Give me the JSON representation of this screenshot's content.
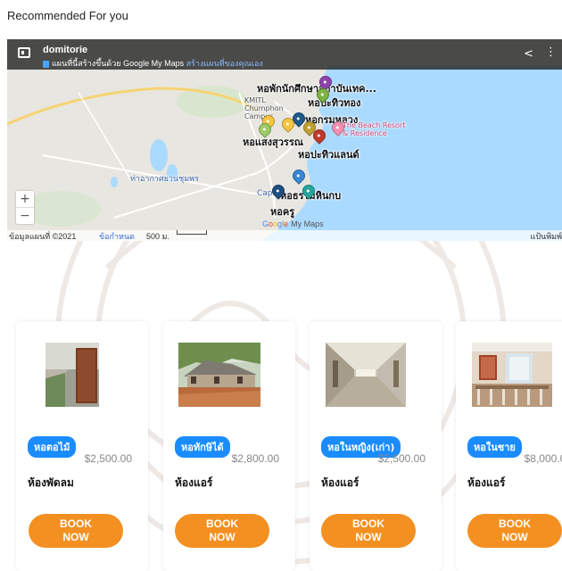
{
  "section_title": "Recommended For you",
  "map": {
    "title": "domitorie",
    "subtitle_text": "แผนที่นี้สร้างขึ้นด้วย Google My Maps",
    "subtitle_link": "สร้างแผนที่ของคุณเอง",
    "icons": [
      "map-menu-icon",
      "info-icon",
      "share-icon",
      "more-icon",
      "zoom-in-icon",
      "zoom-out-icon",
      "map-pin-icon"
    ],
    "places": {
      "kmitl_campus": "KMITL\nChumphon\nCampus",
      "dorm_student": "หอพักนักศึกษาสถาบันเทค...",
      "dorm_pattong": "หอปะทิวทอง",
      "dorm_romluang": "หอกรมหลวง",
      "beach_resort": "The Beach Resort\n& Residence",
      "dorm_saengsuwan": "หอแสงสุวรรณ",
      "dorm_patiw_island": "หอปะทิวแลนด์",
      "airport": "ท่าอากาศยานชุมพร",
      "dorm_hinkob": "หอธรรมหินกบ",
      "capo": "Cap",
      "dorm_khru": "หอครู"
    },
    "zoom_in": "+",
    "zoom_out": "−",
    "google_logo": [
      "G",
      "o",
      "o",
      "g",
      "l",
      "e"
    ],
    "my_maps": "My Maps",
    "footer": {
      "copyright": "ข้อมูลแผนที่ ©2021",
      "terms": "ข้อกำหนด",
      "scale": "500 ม.",
      "keyboard": "แป้นพิมพ์"
    },
    "colors": {
      "sea": "#aadaff",
      "land": "#e8e6e0",
      "road": "#ffffff",
      "highway": "#f6d473"
    }
  },
  "cards": [
    {
      "badge": "หอตอไม้",
      "price": "$2,500.00",
      "name": "ห้องพัดลม",
      "button": "BOOK\nNOW"
    },
    {
      "badge": "หอทักษิได้",
      "price": "$2,800.00",
      "name": "ห้องแอร์",
      "button": "BOOK\nNOW"
    },
    {
      "badge": "หอในหญิง(เก่า)",
      "price": "$2,500.00",
      "name": "ห้องแอร์",
      "button": "BOOK\nNOW"
    },
    {
      "badge": "หอในชาย",
      "price": "$8,000.00",
      "name": "ห้องแอร์",
      "button": "BOOK\nNOW"
    }
  ],
  "colors": {
    "accent": "#f39021",
    "badge": "#1a8cff",
    "price": "#888888"
  }
}
